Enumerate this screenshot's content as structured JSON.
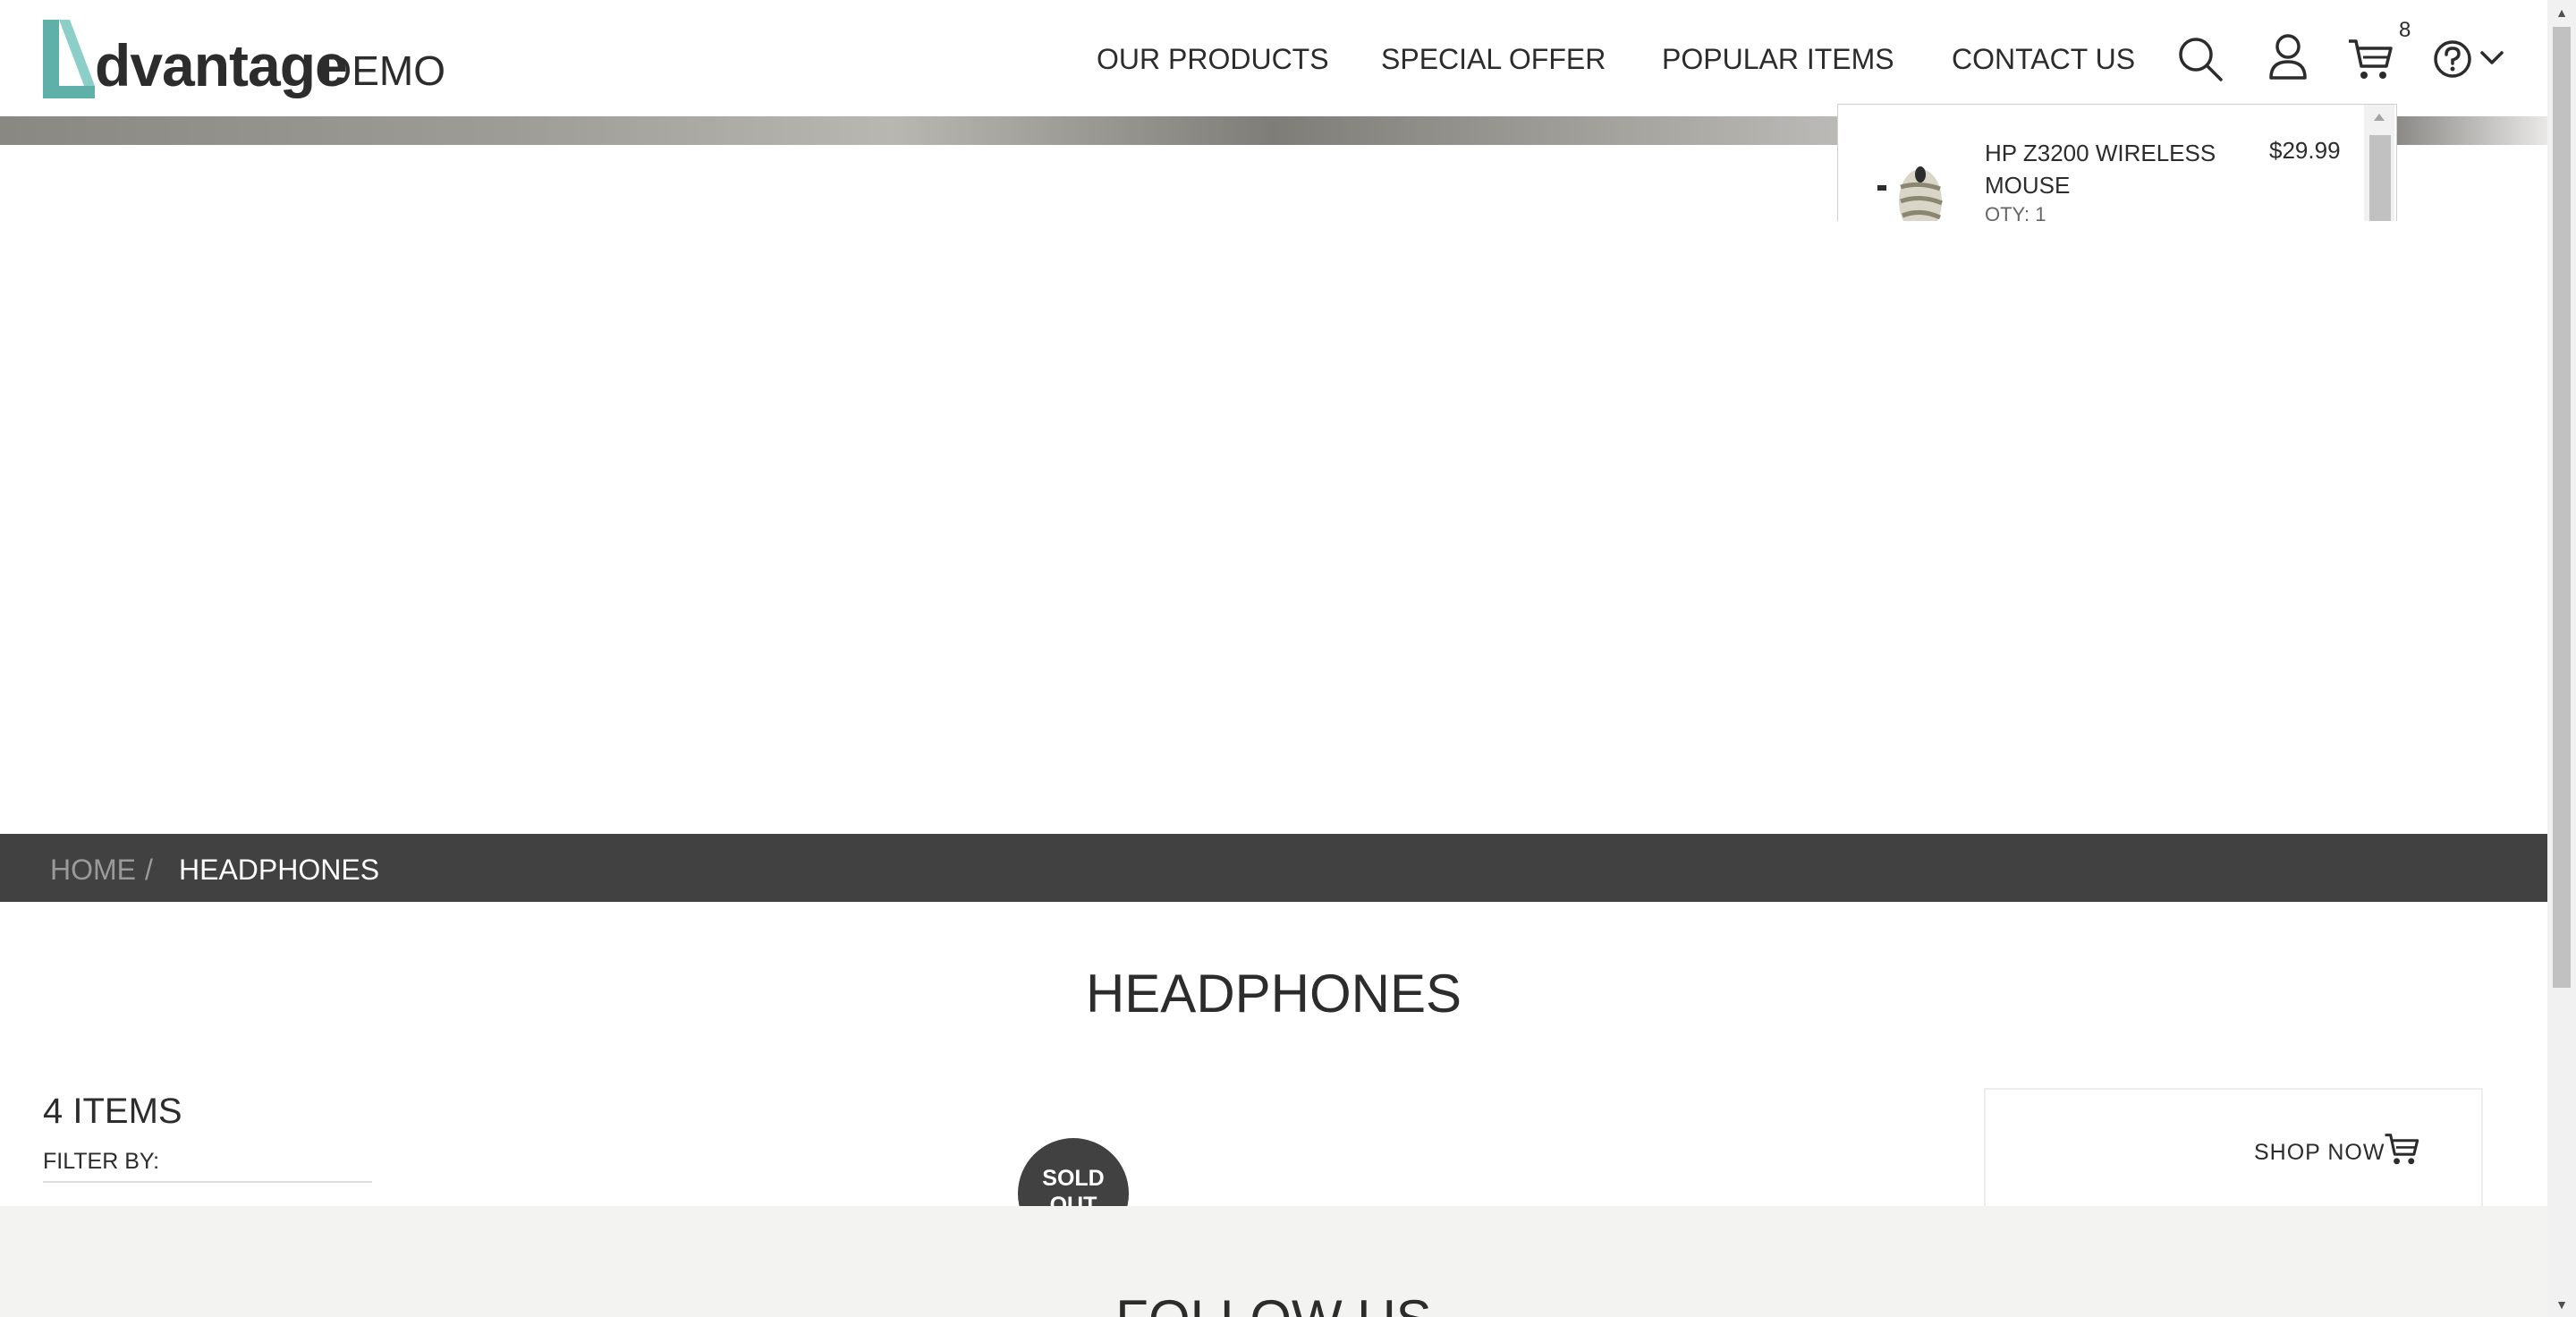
{
  "brand": {
    "name": "dvantage",
    "suffix": "DEMO",
    "color": "#5fb0a9"
  },
  "nav": {
    "items": [
      "OUR PRODUCTS",
      "SPECIAL OFFER",
      "POPULAR ITEMS",
      "CONTACT US"
    ],
    "icons": [
      "search-icon",
      "user-icon",
      "cart-icon",
      "help-icon",
      "chevron-down-icon"
    ],
    "cart_count": "8"
  },
  "cart_popup": {
    "item": {
      "name": "HP Z3200 WIRELESS MOUSE",
      "price": "$29.99",
      "qty": "QTY: 1"
    }
  },
  "breadcrumb": {
    "home": "HOME",
    "separator": "/",
    "current": "HEADPHONES"
  },
  "page": {
    "title": "HEADPHONES",
    "items_count": "4 ITEMS",
    "filter_label": "FILTER BY:",
    "sold_out": "SOLD OUT",
    "shop_now": "SHOP NOW"
  },
  "footer": {
    "follow": "FOLLOW US"
  },
  "colors": {
    "dark_bar": "#414141",
    "accent": "#5fb0a9",
    "footer_bg": "#f3f3f1"
  }
}
